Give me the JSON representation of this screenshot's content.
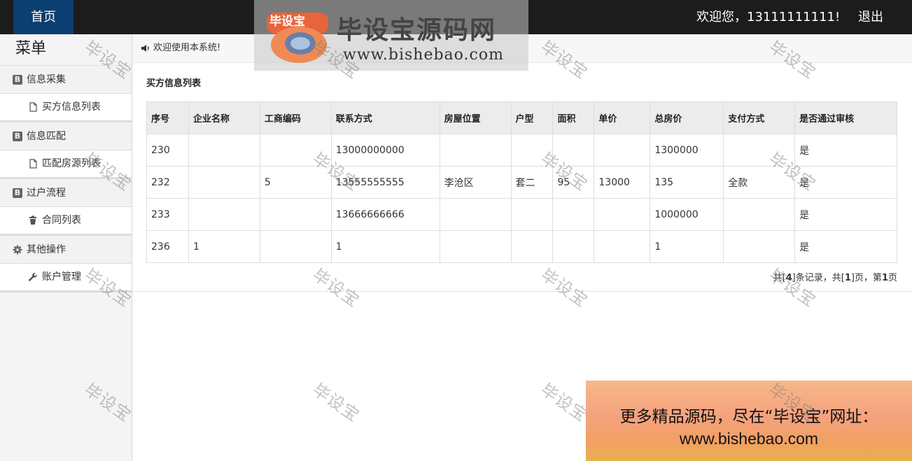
{
  "topbar": {
    "home": "首页",
    "welcome": "欢迎您，13111111111!",
    "logout": "退出"
  },
  "sidebar": {
    "title": "菜单",
    "groups": [
      {
        "label": "信息采集",
        "item": "买方信息列表"
      },
      {
        "label": "信息匹配",
        "item": "匹配房源列表"
      },
      {
        "label": "过户流程",
        "item": "合同列表"
      },
      {
        "label": "其他操作",
        "item": "账户管理"
      }
    ]
  },
  "breadcrumb": {
    "text": "欢迎使用本系统!"
  },
  "list": {
    "title": "买方信息列表",
    "headers": [
      "序号",
      "企业名称",
      "工商编码",
      "联系方式",
      "房屋位置",
      "户型",
      "面积",
      "单价",
      "总房价",
      "支付方式",
      "是否通过审核"
    ],
    "rows": [
      [
        "230",
        "",
        "",
        "13000000000",
        "",
        "",
        "",
        "",
        "1300000",
        "",
        "是"
      ],
      [
        "232",
        "",
        "5",
        "13555555555",
        "李沧区",
        "套二",
        "95",
        "13000",
        "135",
        "全款",
        "是"
      ],
      [
        "233",
        "",
        "",
        "13666666666",
        "",
        "",
        "",
        "",
        "1000000",
        "",
        "是"
      ],
      [
        "236",
        "1",
        "",
        "1",
        "",
        "",
        "",
        "",
        "1",
        "",
        "是"
      ]
    ]
  },
  "pager": {
    "prefix": "共[",
    "records": "4",
    "mid1": "]条记录，共[",
    "pages": "1",
    "mid2": "]页，第",
    "current": "1",
    "suffix": "页"
  },
  "watermark": {
    "text": "毕设宝"
  },
  "logo": {
    "badge": "毕设宝",
    "name": "毕设宝源码网",
    "url": "www.bishebao.com"
  },
  "ad": {
    "line1": "更多精品源码，尽在“毕设宝”网址：",
    "line2": "www.bishebao.com"
  },
  "colors": {
    "topbar": "#1c1c1c",
    "home_bg": "#0b3e71",
    "header_bg": "#ececec"
  }
}
